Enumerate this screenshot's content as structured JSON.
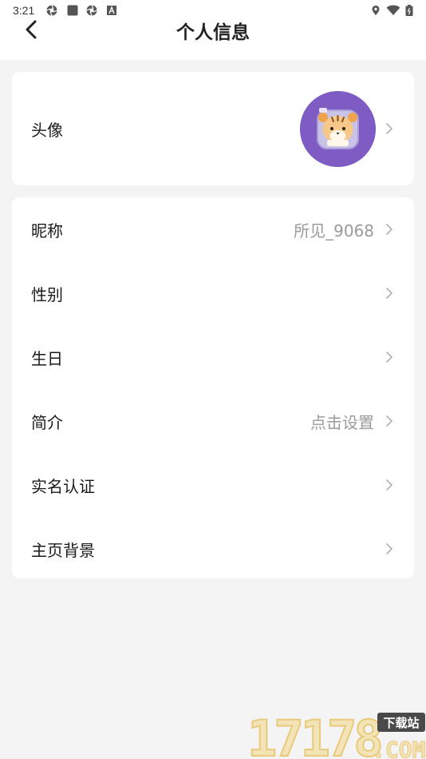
{
  "status_bar": {
    "time": "3:21",
    "left_icons": [
      "aperture-icon",
      "square-icon",
      "aperture-icon",
      "a-badge-icon"
    ],
    "right_icons": [
      "location-icon",
      "wifi-icon",
      "battery-icon"
    ]
  },
  "header": {
    "title": "个人信息",
    "back_icon": "chevron-left-icon"
  },
  "avatar_card": {
    "label": "头像",
    "avatar_icon": "tiger-avatar-icon",
    "avatar_bg": "#7f5cc4"
  },
  "info_list": [
    {
      "label": "昵称",
      "value": "所见_9068"
    },
    {
      "label": "性别",
      "value": ""
    },
    {
      "label": "生日",
      "value": ""
    },
    {
      "label": "简介",
      "value": "点击设置"
    },
    {
      "label": "实名认证",
      "value": ""
    },
    {
      "label": "主页背景",
      "value": ""
    }
  ],
  "watermark": {
    "number": "17178",
    "suffix": ".COM",
    "tag": "下载站"
  },
  "colors": {
    "page_bg": "#f4f4f4",
    "card_bg": "#ffffff",
    "value_text": "#9a9a9a",
    "chevron": "#b5b5b5"
  }
}
